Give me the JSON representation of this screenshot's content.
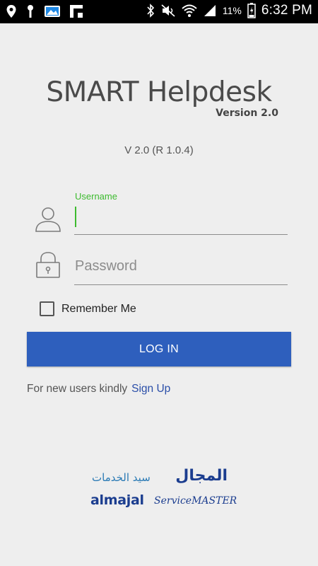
{
  "status_bar": {
    "battery_percent": "11%",
    "time": "6:32 PM",
    "icons": [
      "location-icon",
      "key-icon",
      "gallery-icon",
      "flipboard-icon",
      "bluetooth-icon",
      "mute-icon",
      "wifi-icon",
      "signal-icon",
      "battery-icon"
    ]
  },
  "header": {
    "title": "SMART Helpdesk",
    "subtitle": "Version 2.0",
    "version_line": "V 2.0 (R 1.0.4)"
  },
  "form": {
    "username": {
      "label": "Username",
      "value": ""
    },
    "password": {
      "placeholder": "Password",
      "value": ""
    },
    "remember_label": "Remember Me",
    "remember_checked": false,
    "login_label": "LOG IN",
    "signup_prompt": "For new users kindly",
    "signup_link": "Sign Up"
  },
  "logo": {
    "arabic_main": "المجال",
    "arabic_sub": "سيد الخدمات",
    "latin_main": "almajal",
    "latin_sub": "ServiceMASTER"
  },
  "colors": {
    "accent_green": "#3dbb2f",
    "button_blue": "#2e5fbd",
    "link_blue": "#2a4ea8",
    "logo_blue": "#1b3d8f"
  }
}
